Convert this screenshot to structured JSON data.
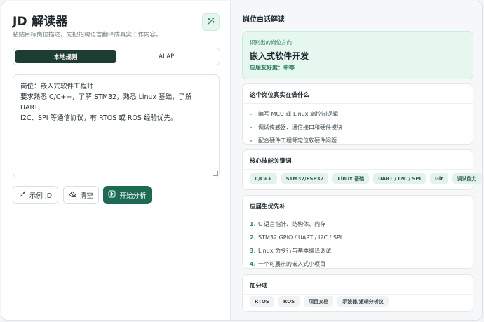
{
  "app": {
    "title": "JD 解读器",
    "subtitle": "粘贴目标岗位描述，先把招聘语言翻译成真实工作内容。"
  },
  "mode_tabs": [
    {
      "label": "本地规则",
      "active": true
    },
    {
      "label": "AI API",
      "active": false
    }
  ],
  "jd_input": {
    "value": "岗位：嵌入式软件工程师\n要求熟悉 C/C++，了解 STM32，熟悉 Linux 基础，了解 UART、\nI2C、SPI 等通信协议，有 RTOS 或 ROS 经验优先。"
  },
  "actions": {
    "example_label": "示例 JD",
    "clear_label": "清空",
    "analyze_label": "开始分析"
  },
  "result": {
    "heading": "岗位白话解读",
    "direction": {
      "label": "识别出的岗位方向",
      "value": "嵌入式软件开发",
      "friendliness": "应届友好度：中等"
    },
    "work": {
      "title": "这个岗位真实在做什么",
      "items": [
        "编写 MCU 或 Linux 端控制逻辑",
        "调试传感器、通信接口和硬件模块",
        "配合硬件工程师定位软硬件问题"
      ]
    },
    "skills": {
      "title": "核心技能关键词",
      "items": [
        "C/C++",
        "STM32/ESP32",
        "Linux 基础",
        "UART / I2C / SPI",
        "Git",
        "调试能力"
      ]
    },
    "priorities": {
      "title": "应届生优先补",
      "items": [
        "C 语言指针、结构体、内存",
        "STM32 GPIO / UART / I2C / SPI",
        "Linux 命令行与基本编译调试",
        "一个可展示的嵌入式小项目"
      ]
    },
    "bonus": {
      "title": "加分项",
      "items": [
        "RTOS",
        "ROS",
        "项目文档",
        "示波器/逻辑分析仪"
      ]
    }
  },
  "colors": {
    "accent": "#1e6b55",
    "accent_dark": "#1e3d32",
    "accent_light": "#e6f7ef"
  },
  "icons": {
    "wand": "magic-wand-icon",
    "example": "magic-wand-icon",
    "clear": "eraser-icon",
    "analyze": "play-icon"
  }
}
